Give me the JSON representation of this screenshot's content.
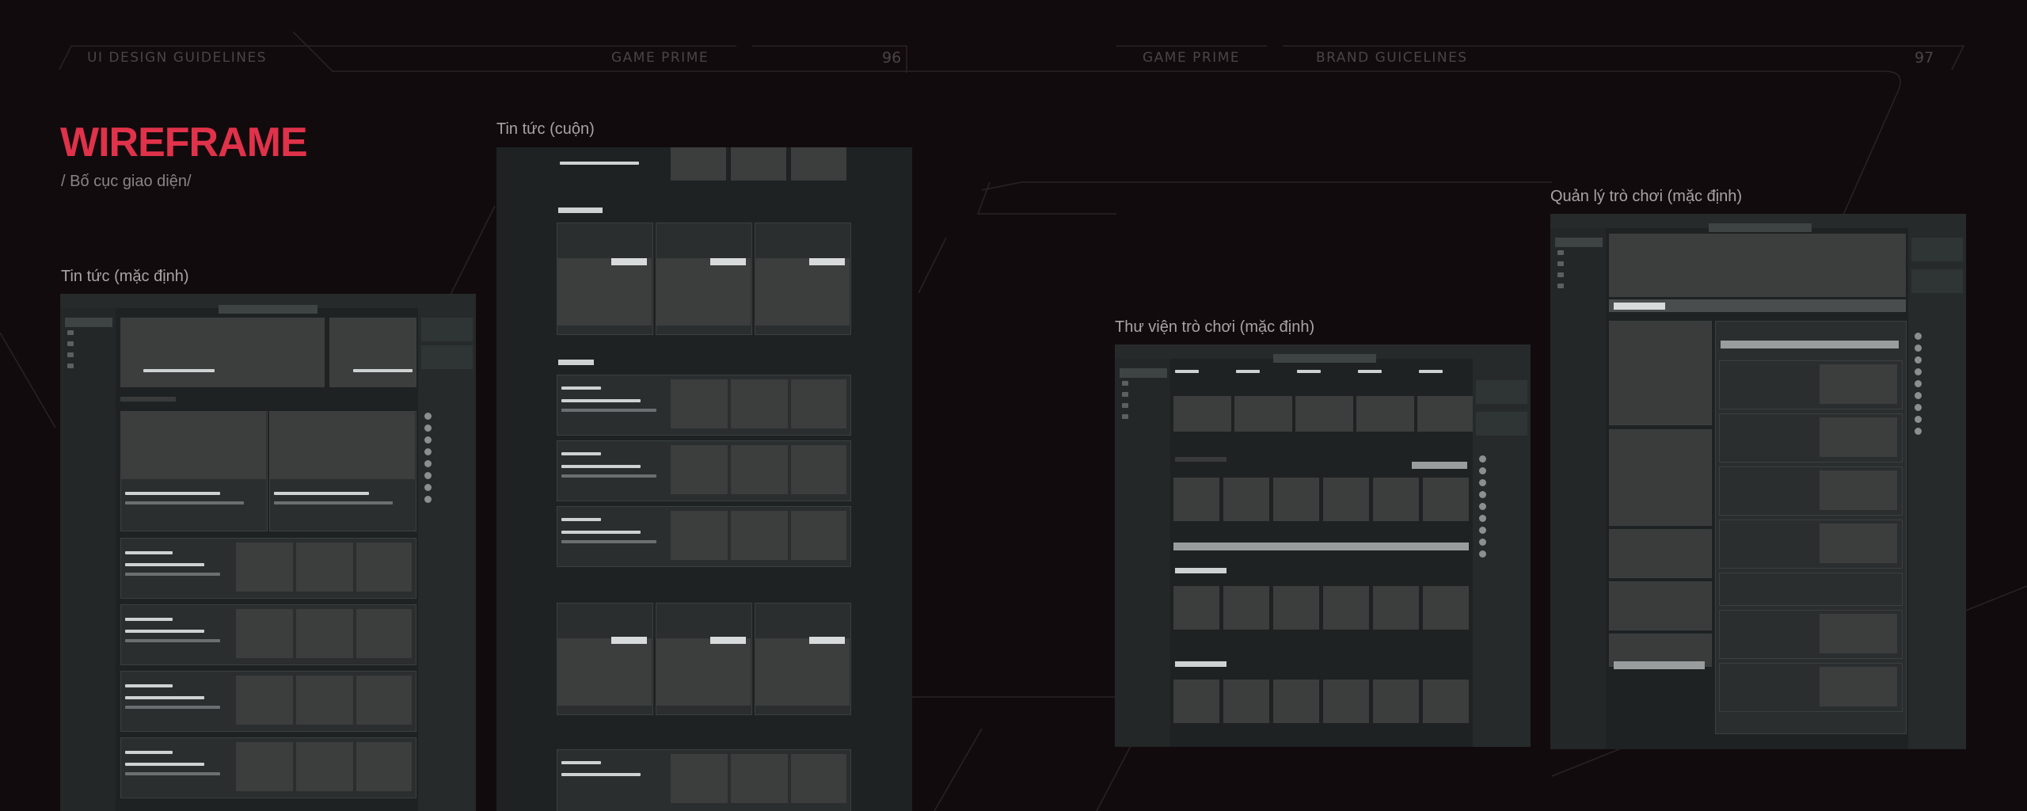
{
  "header": {
    "left_section": "UI DESIGN GUIDELINES",
    "left_brand": "GAME PRIME",
    "left_page": "96",
    "right_brand": "GAME PRIME",
    "right_section": "BRAND GUICELINES",
    "right_page": "97"
  },
  "heading": {
    "title": "WIREFRAME",
    "subtitle": "/ Bố cục giao diện/"
  },
  "labels": {
    "news_default": "Tin tức (mặc định)",
    "news_scroll": "Tin tức (cuộn)",
    "library_default": "Thư viện trò chơi (mặc định)",
    "manage_default": "Quản lý trò chơi (mặc định)"
  },
  "colors": {
    "background": "#120b0d",
    "accent": "#e0324a",
    "frame": "#1e2222"
  }
}
